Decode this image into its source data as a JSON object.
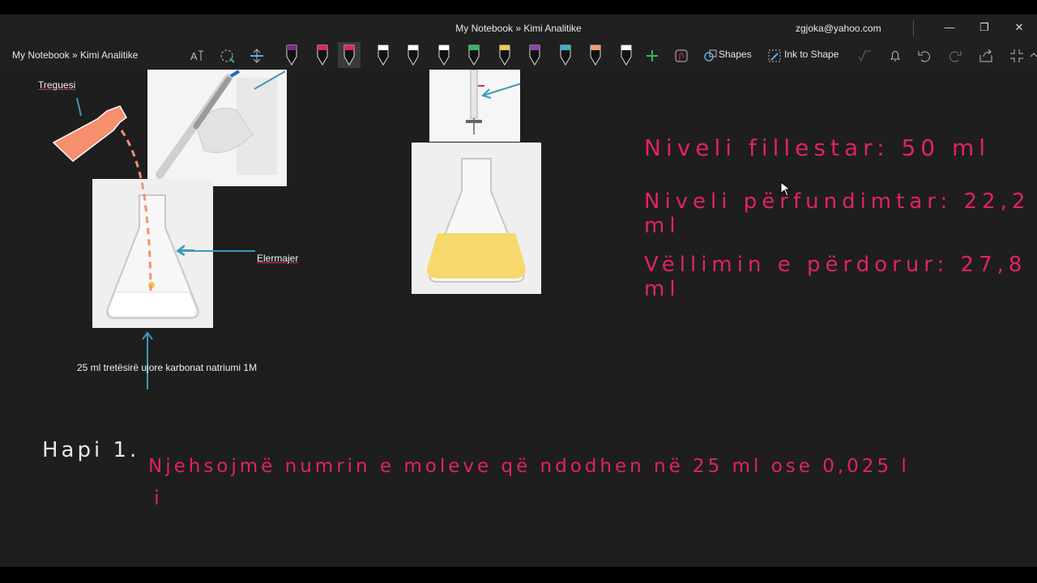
{
  "window": {
    "title": "My Notebook » Kimi Analitike",
    "account": "zgjoka@yahoo.com",
    "minimize_glyph": "—",
    "restore_glyph": "❐",
    "close_glyph": "✕"
  },
  "toolbar": {
    "breadcrumb": "My Notebook » Kimi Analitike",
    "shapes_label": "Shapes",
    "ink_to_shape_label": "Ink to Shape",
    "pen_colors": [
      "#7a2a8a",
      "#e0245e",
      "#e0245e",
      "#ffffff",
      "#ffffff",
      "#ffffff",
      "#2dbd57",
      "#f2c94c",
      "#8e44ad",
      "#3bb3c9",
      "#f39c6b",
      "#ffffff"
    ]
  },
  "canvas": {
    "label_treguesi": "Treguesi",
    "label_elermajer": "Elermajer",
    "label_solution": "25 ml tretësirë ujore karbonat natriumi  1M",
    "ink_line1": "Niveli fillestar: 50 ml",
    "ink_line2": "Niveli përfundimtar: 22,2 ml",
    "ink_line3": "Vëllimin e përdorur: 27,8 ml",
    "hapi": "Hapi 1.",
    "ink_step": "Njehsojmë numrin e moleve që ndodhen në 25 ml ose 0,025 l",
    "ink_step_cont": "i"
  }
}
